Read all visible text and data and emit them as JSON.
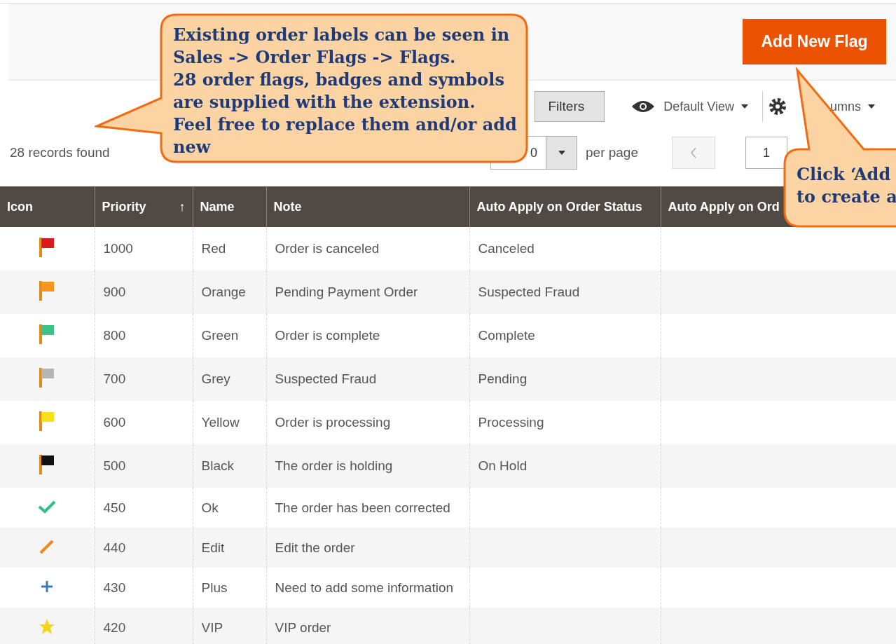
{
  "header": {
    "add_button": "Add New Flag"
  },
  "toolbar": {
    "filters_button": "Filters",
    "view_button": "Default View",
    "columns_button": "umns"
  },
  "pager": {
    "records": "28 records found",
    "per_page_value": "0",
    "per_page_label": "per page",
    "page": "1"
  },
  "table": {
    "columns": [
      {
        "label": "Icon"
      },
      {
        "label": "Priority",
        "sort_indicator": "↑"
      },
      {
        "label": "Name"
      },
      {
        "label": "Note"
      },
      {
        "label": "Auto Apply on Order Status"
      },
      {
        "label": "Auto Apply on Ord"
      }
    ],
    "rows": [
      {
        "icon": {
          "kind": "flag",
          "color": "#d71a1a"
        },
        "priority": "1000",
        "name": "Red",
        "note": "Order is canceled",
        "status": "Canceled"
      },
      {
        "icon": {
          "kind": "flag",
          "color": "#f7931e"
        },
        "priority": "900",
        "name": "Orange",
        "note": "Pending Payment Order",
        "status": "Suspected Fraud"
      },
      {
        "icon": {
          "kind": "flag",
          "color": "#3cc38a"
        },
        "priority": "800",
        "name": "Green",
        "note": "Order is complete",
        "status": "Complete"
      },
      {
        "icon": {
          "kind": "flag",
          "color": "#b5b5b5"
        },
        "priority": "700",
        "name": "Grey",
        "note": "Suspected Fraud",
        "status": "Pending"
      },
      {
        "icon": {
          "kind": "flag",
          "color": "#f5e01a"
        },
        "priority": "600",
        "name": "Yellow",
        "note": "Order is processing",
        "status": "Processing"
      },
      {
        "icon": {
          "kind": "flag",
          "color": "#111111"
        },
        "priority": "500",
        "name": "Black",
        "note": "The order is holding",
        "status": "On Hold"
      },
      {
        "icon": {
          "kind": "check",
          "color": "#2fbf7f"
        },
        "priority": "450",
        "name": "Ok",
        "note": "The order has been corrected"
      },
      {
        "icon": {
          "kind": "pencil",
          "color": "#f08a1c"
        },
        "priority": "440",
        "name": "Edit",
        "note": "Edit the order"
      },
      {
        "icon": {
          "kind": "plus",
          "color": "#3a7ab8"
        },
        "priority": "430",
        "name": "Plus",
        "note": "Need to add some information"
      },
      {
        "icon": {
          "kind": "star",
          "color": "#f2d814"
        },
        "priority": "420",
        "name": "VIP",
        "note": "VIP order"
      }
    ]
  },
  "callouts": [
    {
      "text": "Existing order labels can be seen in\nSales -> Order Flags -> Flags.\n28 order flags, badges and symbols\nare supplied with the extension.\nFeel free to replace them and/or add\nnew"
    },
    {
      "text": "Click ‘Add\nto create a"
    }
  ]
}
